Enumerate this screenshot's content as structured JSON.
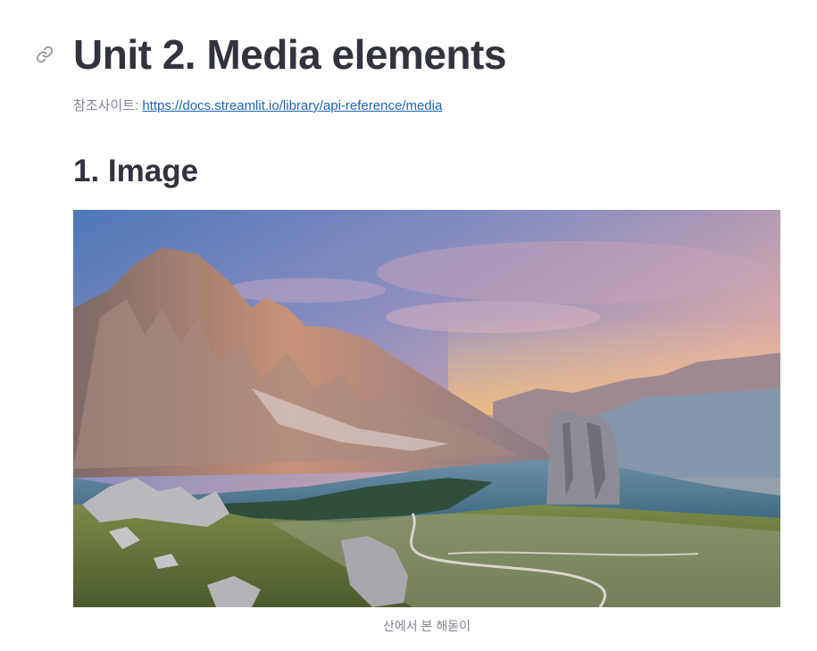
{
  "header": {
    "title": "Unit 2. Media elements",
    "anchor_icon": "link-icon"
  },
  "reference": {
    "label": "참조사이트:",
    "url_text": "https://docs.streamlit.io/library/api-reference/media"
  },
  "section": {
    "heading": "1. Image"
  },
  "image": {
    "caption": "산에서 본 해돋이",
    "alt": "산에서 본 해돋이"
  },
  "colors": {
    "text": "#31333f",
    "muted": "#808495",
    "link": "#1c64b8"
  }
}
